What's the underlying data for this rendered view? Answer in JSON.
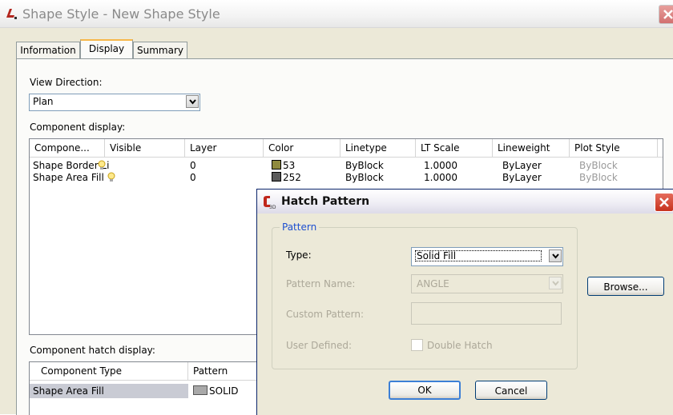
{
  "main_window": {
    "title": "Shape Style - New Shape Style",
    "tabs": [
      "Information",
      "Display",
      "Summary"
    ],
    "active_tab": "Display"
  },
  "display_tab": {
    "view_direction_label": "View Direction:",
    "view_direction_value": "Plan",
    "component_display_label": "Component display:",
    "component_columns": [
      "Compone...",
      "Visible",
      "Layer",
      "Color",
      "Linetype",
      "LT Scale",
      "Lineweight",
      "Plot Style"
    ],
    "component_rows": [
      {
        "component": "Shape Border Li",
        "layer": "0",
        "color": "53",
        "color_hex": "#8f8a3e",
        "linetype": "ByBlock",
        "lt_scale": "1.0000",
        "lineweight": "ByLayer",
        "plot_style": "ByBlock"
      },
      {
        "component": "Shape Area Fill",
        "layer": "0",
        "color": "252",
        "color_hex": "#5a5a5a",
        "linetype": "ByBlock",
        "lt_scale": "1.0000",
        "lineweight": "ByLayer",
        "plot_style": "ByBlock"
      }
    ],
    "component_hatch_label": "Component hatch display:",
    "hatch_columns": [
      "Component Type",
      "Pattern"
    ],
    "hatch_rows": [
      {
        "component_type": "Shape Area Fill",
        "pattern": "SOLID",
        "pattern_swatch_hex": "#a9a9a9"
      }
    ]
  },
  "hatch_dialog": {
    "title": "Hatch Pattern",
    "group_label": "Pattern",
    "type_label": "Type:",
    "type_value": "Solid Fill",
    "pattern_name_label": "Pattern Name:",
    "pattern_name_value": "ANGLE",
    "custom_pattern_label": "Custom Pattern:",
    "custom_pattern_value": "",
    "user_defined_label": "User Defined:",
    "double_hatch_label": "Double Hatch",
    "browse_label": "Browse...",
    "ok_label": "OK",
    "cancel_label": "Cancel"
  },
  "icons": {
    "app_icon": "autocad-icon",
    "close_icon": "close-icon",
    "dropdown_icon": "chevron-down-icon",
    "visibility_icon": "lightbulb-icon"
  }
}
